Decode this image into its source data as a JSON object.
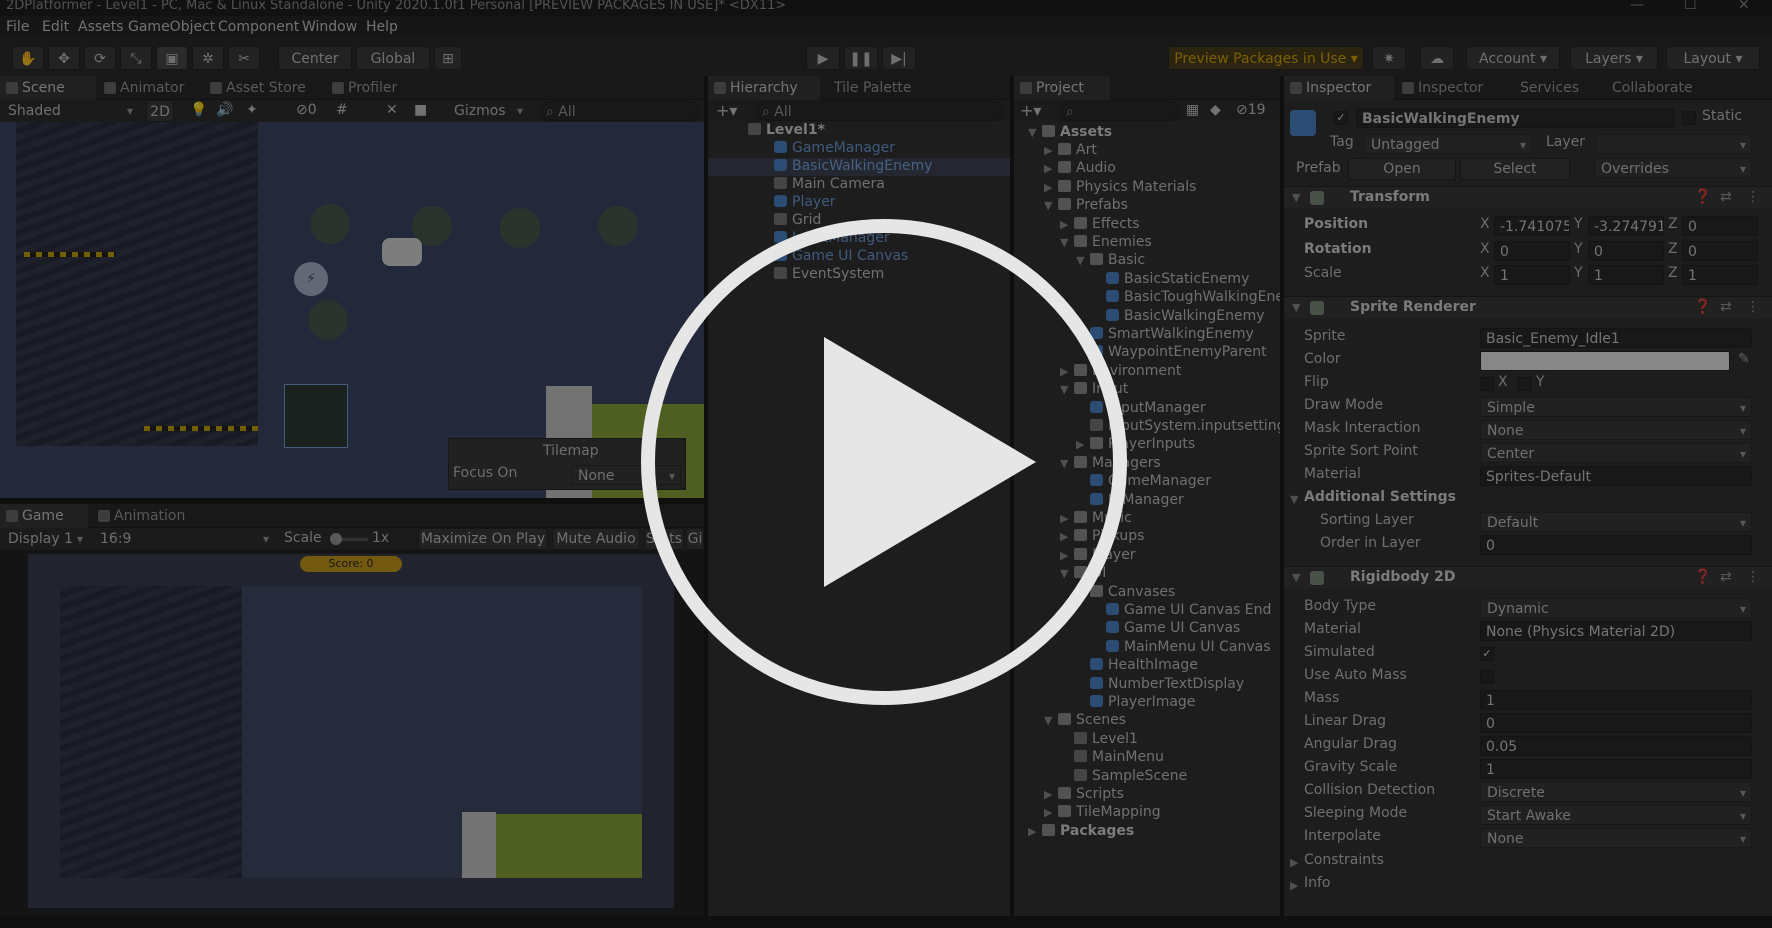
{
  "window": {
    "title": "2DPlatformer - Level1 - PC, Mac & Linux Standalone - Unity 2020.1.0f1 Personal [PREVIEW PACKAGES IN USE]* <DX11>"
  },
  "menu": [
    "File",
    "Edit",
    "Assets",
    "GameObject",
    "Component",
    "Window",
    "Help"
  ],
  "toolbar": {
    "center_label": "Center",
    "global_label": "Global",
    "preview_packages": "Preview Packages in Use",
    "account": "Account",
    "layers": "Layers",
    "layout": "Layout"
  },
  "scene_panel": {
    "tabs": [
      "Scene",
      "Animator",
      "Asset Store",
      "Profiler"
    ],
    "shading": "Shaded",
    "mode_2d": "2D",
    "hidden_count": "0",
    "gizmos": "Gizmos",
    "search_placeholder": "All",
    "tilemap_title": "Tilemap",
    "focus_on_label": "Focus On",
    "focus_on_value": "None"
  },
  "game_panel": {
    "tabs": [
      "Game",
      "Animation"
    ],
    "display": "Display 1",
    "aspect": "16:9",
    "scale_label": "Scale",
    "scale_value": "1x",
    "maximize": "Maximize On Play",
    "mute": "Mute Audio",
    "stats": "Stats",
    "gizmos": "Gi",
    "score": "Score: 0"
  },
  "hierarchy": {
    "tabs": [
      "Hierarchy",
      "Tile Palette"
    ],
    "search_placeholder": "All",
    "root": "Level1*",
    "items": [
      "GameManager",
      "BasicWalkingEnemy",
      "Main Camera",
      "Player",
      "Grid",
      "InputManager",
      "Game UI Canvas",
      "EventSystem"
    ]
  },
  "project": {
    "tab": "Project",
    "count": "19",
    "assets": "Assets",
    "tree": [
      "Art",
      "Audio",
      "Physics Materials",
      "Prefabs",
      "Effects",
      "Enemies",
      "Basic",
      "BasicStaticEnemy",
      "BasicToughWalkingEnemy",
      "BasicWalkingEnemy",
      "SmartWalkingEnemy",
      "WaypointEnemyParent",
      "Environment",
      "Input",
      "InputManager",
      "InputSystem.inputsettings",
      "PlayerInputs",
      "Managers",
      "GameManager",
      "UIManager",
      "Music",
      "Pickups",
      "Player",
      "UI",
      "Canvases",
      "Game UI Canvas End",
      "Game UI Canvas",
      "MainMenu UI Canvas",
      "HealthImage",
      "NumberTextDisplay",
      "PlayerImage",
      "Scenes",
      "Level1",
      "MainMenu",
      "SampleScene",
      "Scripts",
      "TileMapping",
      "Packages"
    ]
  },
  "inspector": {
    "tabs": [
      "Inspector",
      "Inspector",
      "Services",
      "Collaborate"
    ],
    "object_name": "BasicWalkingEnemy",
    "static_label": "Static",
    "tag_label": "Tag",
    "tag_value": "Untagged",
    "layer_label": "Layer",
    "prefab_label": "Prefab",
    "open_label": "Open",
    "select_label": "Select",
    "overrides_label": "Overrides",
    "transform": {
      "title": "Transform",
      "position_label": "Position",
      "rotation_label": "Rotation",
      "scale_label": "Scale",
      "position": {
        "x": "-1.741075",
        "y": "-3.274791",
        "z": "0"
      },
      "rotation": {
        "x": "0",
        "y": "0",
        "z": "0"
      },
      "scale": {
        "x": "1",
        "y": "1",
        "z": "1"
      }
    },
    "sprite_renderer": {
      "title": "Sprite Renderer",
      "sprite_label": "Sprite",
      "sprite": "Basic_Enemy_Idle1",
      "color_label": "Color",
      "flip_label": "Flip",
      "flip_x": "X",
      "flip_y": "Y",
      "draw_mode_label": "Draw Mode",
      "draw_mode": "Simple",
      "mask_label": "Mask Interaction",
      "mask": "None",
      "sort_point_label": "Sprite Sort Point",
      "sort_point": "Center",
      "material_label": "Material",
      "material": "Sprites-Default",
      "additional_label": "Additional Settings",
      "sorting_layer_label": "Sorting Layer",
      "sorting_layer": "Default",
      "order_label": "Order in Layer",
      "order": "0"
    },
    "rigidbody": {
      "title": "Rigidbody 2D",
      "body_type_label": "Body Type",
      "body_type": "Dynamic",
      "material_label": "Material",
      "material": "None (Physics Material 2D)",
      "simulated_label": "Simulated",
      "auto_mass_label": "Use Auto Mass",
      "mass_label": "Mass",
      "mass": "1",
      "linear_drag_label": "Linear Drag",
      "linear_drag": "0",
      "angular_drag_label": "Angular Drag",
      "angular_drag": "0.05",
      "gravity_label": "Gravity Scale",
      "gravity": "1",
      "collision_label": "Collision Detection",
      "collision": "Discrete",
      "sleep_label": "Sleeping Mode",
      "sleep": "Start Awake",
      "interpolate_label": "Interpolate",
      "interpolate": "None",
      "constraints_label": "Constraints",
      "info_label": "Info"
    }
  }
}
